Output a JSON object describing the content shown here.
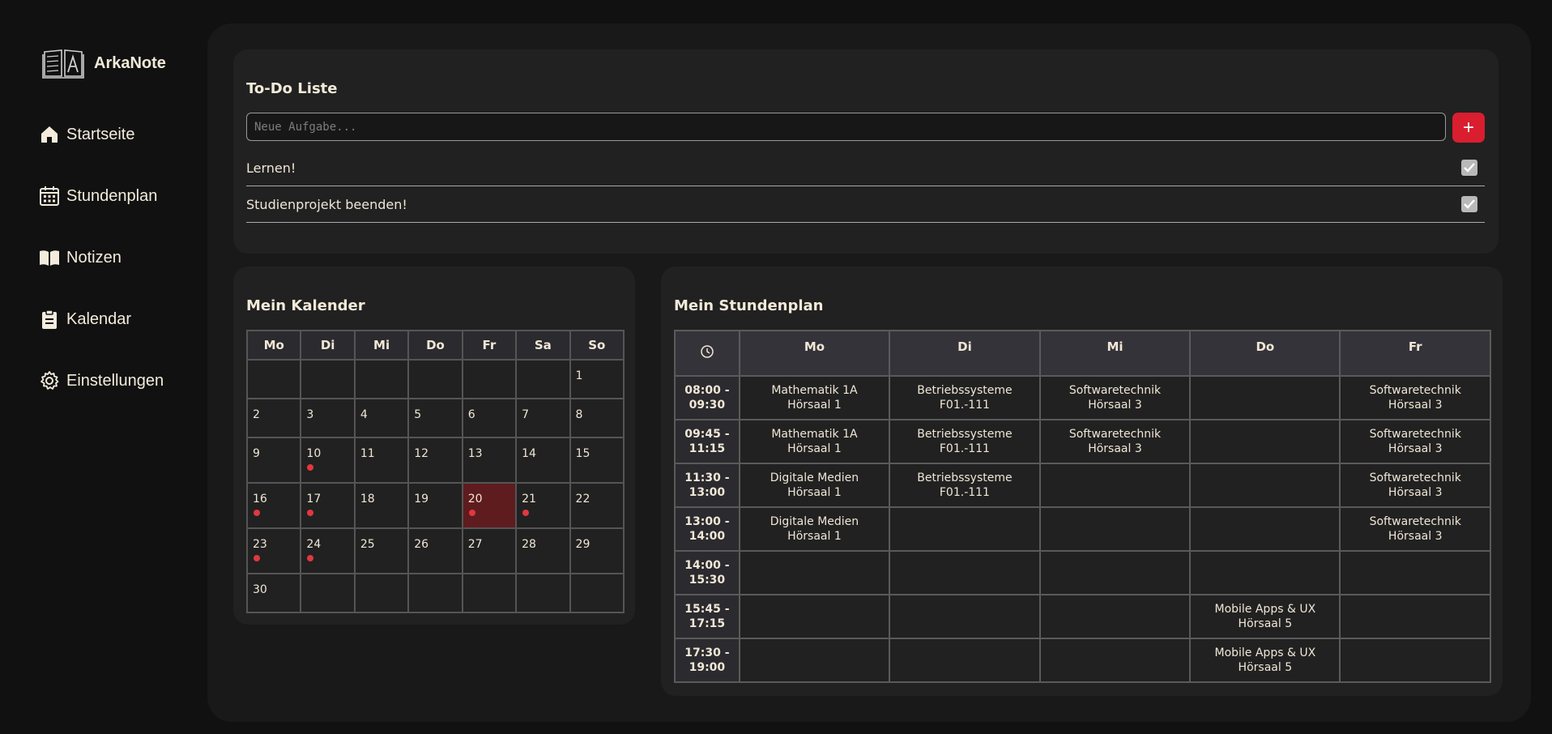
{
  "app": {
    "name": "ArkaNote"
  },
  "sidebar": {
    "items": [
      {
        "label": "Startseite",
        "icon": "home-icon"
      },
      {
        "label": "Stundenplan",
        "icon": "calendar-grid-icon"
      },
      {
        "label": "Notizen",
        "icon": "book-open-icon"
      },
      {
        "label": "Kalendar",
        "icon": "clipboard-icon"
      },
      {
        "label": "Einstellungen",
        "icon": "gear-icon"
      }
    ]
  },
  "todo": {
    "title": "To-Do Liste",
    "placeholder": "Neue Aufgabe...",
    "add_label": "+",
    "items": [
      {
        "text": "Lernen!",
        "checked": true
      },
      {
        "text": "Studienprojekt beenden!",
        "checked": true
      }
    ]
  },
  "calendar": {
    "title": "Mein Kalender",
    "weekdays": [
      "Mo",
      "Di",
      "Mi",
      "Do",
      "Fr",
      "Sa",
      "So"
    ],
    "weeks": [
      [
        "",
        "",
        "",
        "",
        "",
        "",
        "1"
      ],
      [
        "2",
        "3",
        "4",
        "5",
        "6",
        "7",
        "8"
      ],
      [
        "9",
        "10",
        "11",
        "12",
        "13",
        "14",
        "15"
      ],
      [
        "16",
        "17",
        "18",
        "19",
        "20",
        "21",
        "22"
      ],
      [
        "23",
        "24",
        "25",
        "26",
        "27",
        "28",
        "29"
      ],
      [
        "30",
        "",
        "",
        "",
        "",
        "",
        ""
      ]
    ],
    "event_days": [
      "10",
      "16",
      "17",
      "20",
      "21",
      "23",
      "24"
    ],
    "today": "20",
    "colors": {
      "event_dot": "#e0383e",
      "today_bg": "#5e1c1f"
    }
  },
  "timetable": {
    "title": "Mein Stundenplan",
    "time_icon": "clock-icon",
    "days": [
      "Mo",
      "Di",
      "Mi",
      "Do",
      "Fr"
    ],
    "rows": [
      {
        "time": [
          "08:00 -",
          "09:30"
        ],
        "cells": [
          [
            "Mathematik 1A",
            "Hörsaal 1"
          ],
          [
            "Betriebssysteme",
            "F01.-111"
          ],
          [
            "Softwaretechnik",
            "Hörsaal 3"
          ],
          [],
          [
            "Softwaretechnik",
            "Hörsaal 3"
          ]
        ]
      },
      {
        "time": [
          "09:45 -",
          "11:15"
        ],
        "cells": [
          [
            "Mathematik 1A",
            "Hörsaal 1"
          ],
          [
            "Betriebssysteme",
            "F01.-111"
          ],
          [
            "Softwaretechnik",
            "Hörsaal 3"
          ],
          [],
          [
            "Softwaretechnik",
            "Hörsaal 3"
          ]
        ]
      },
      {
        "time": [
          "11:30 -",
          "13:00"
        ],
        "cells": [
          [
            "Digitale Medien",
            "Hörsaal 1"
          ],
          [
            "Betriebssysteme",
            "F01.-111"
          ],
          [],
          [],
          [
            "Softwaretechnik",
            "Hörsaal 3"
          ]
        ]
      },
      {
        "time": [
          "13:00 -",
          "14:00"
        ],
        "cells": [
          [
            "Digitale Medien",
            "Hörsaal 1"
          ],
          [],
          [],
          [],
          [
            "Softwaretechnik",
            "Hörsaal 3"
          ]
        ]
      },
      {
        "time": [
          "14:00 -",
          "15:30"
        ],
        "cells": [
          [],
          [],
          [],
          [],
          []
        ]
      },
      {
        "time": [
          "15:45 -",
          "17:15"
        ],
        "cells": [
          [],
          [],
          [],
          [
            "Mobile Apps & UX",
            "Hörsaal 5"
          ],
          []
        ]
      },
      {
        "time": [
          "17:30 -",
          "19:00"
        ],
        "cells": [
          [],
          [],
          [],
          [
            "Mobile Apps & UX",
            "Hörsaal 5"
          ],
          []
        ]
      }
    ]
  },
  "colors": {
    "accent": "#d91e2f",
    "background": "#111111",
    "panel": "#191919",
    "card": "#212121"
  }
}
